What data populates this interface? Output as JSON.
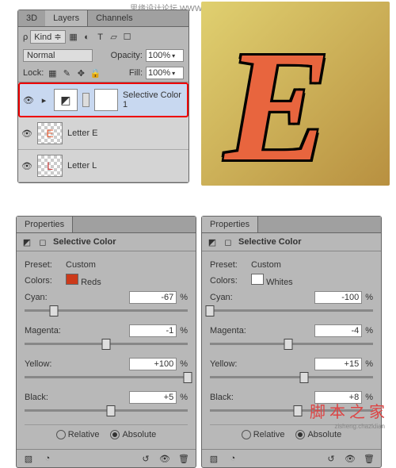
{
  "watermark_top": "思缘设计论坛  WWW.MISSYUAN.COM",
  "watermark_bottom": "脚 本 之 家",
  "watermark_url": "zisheng.chazidian",
  "layers_panel": {
    "tabs": [
      "3D",
      "Layers",
      "Channels"
    ],
    "kind_label": "Kind",
    "blend_mode": "Normal",
    "opacity_label": "Opacity:",
    "opacity_value": "100%",
    "lock_label": "Lock:",
    "fill_label": "Fill:",
    "fill_value": "100%",
    "layers": [
      {
        "name": "Selective Color 1",
        "selected": true
      },
      {
        "name": "Letter E",
        "selected": false
      },
      {
        "name": "Letter L",
        "selected": false
      }
    ]
  },
  "props_left": {
    "tab": "Properties",
    "title": "Selective Color",
    "preset_label": "Preset:",
    "preset_value": "Custom",
    "colors_label": "Colors:",
    "colors_value": "Reds",
    "swatch": "#cc3a1a",
    "sliders": [
      {
        "label": "Cyan:",
        "value": "-67",
        "pos": 18
      },
      {
        "label": "Magenta:",
        "value": "-1",
        "pos": 50
      },
      {
        "label": "Yellow:",
        "value": "+100",
        "pos": 100
      },
      {
        "label": "Black:",
        "value": "+5",
        "pos": 53
      }
    ],
    "relative": "Relative",
    "absolute": "Absolute"
  },
  "props_right": {
    "tab": "Properties",
    "title": "Selective Color",
    "preset_label": "Preset:",
    "preset_value": "Custom",
    "colors_label": "Colors:",
    "colors_value": "Whites",
    "swatch": "#ffffff",
    "sliders": [
      {
        "label": "Cyan:",
        "value": "-100",
        "pos": 0
      },
      {
        "label": "Magenta:",
        "value": "-4",
        "pos": 48
      },
      {
        "label": "Yellow:",
        "value": "+15",
        "pos": 58
      },
      {
        "label": "Black:",
        "value": "+8",
        "pos": 54
      }
    ],
    "relative": "Relative",
    "absolute": "Absolute"
  },
  "pct": "%"
}
